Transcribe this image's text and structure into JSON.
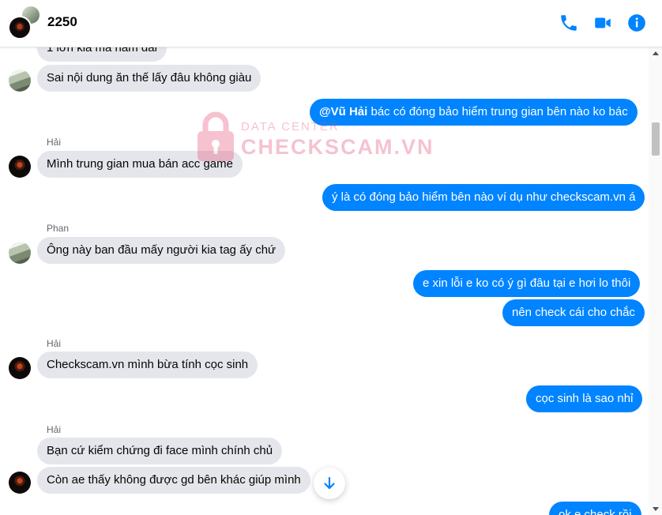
{
  "header": {
    "title": "2250",
    "icons": [
      "phone-icon",
      "video-icon",
      "info-icon"
    ],
    "accent_color": "#0084ff"
  },
  "watermark": {
    "line1": "DATA CENTER",
    "line2": "CHECKSCAM.VN",
    "icon": "lock-icon"
  },
  "messages": [
    {
      "side": "in",
      "sender": "",
      "text": "1 lớn kia mà nằm dài"
    },
    {
      "side": "in",
      "sender": "",
      "text": "Sai nội dung ăn thế lấy đâu không giàu"
    },
    {
      "side": "out",
      "mention": "@Vũ Hải",
      "text": " bác có đóng bảo hiểm trung gian bên nào ko bác"
    },
    {
      "side": "in",
      "sender": "Hải",
      "text": "Mình trung gian mua bán acc game"
    },
    {
      "side": "out",
      "text": "ý là có đóng bảo hiểm bên nào ví dụ như checkscam.vn á"
    },
    {
      "side": "in",
      "sender": "Phan",
      "text": "Ông này ban đầu mấy người kia tag ấy chứ"
    },
    {
      "side": "out",
      "text": "e xin lỗi e ko có ý gì đâu tại e hơi lo thôi"
    },
    {
      "side": "out",
      "text": "nên check cái cho chắc"
    },
    {
      "side": "in",
      "sender": "Hải",
      "text": "Checkscam.vn mình bừa tính cọc sinh"
    },
    {
      "side": "out",
      "text": "cọc sinh là sao nhỉ"
    },
    {
      "side": "in",
      "sender": "Hải",
      "text": "Bạn cứ kiểm chứng đi face mình chính chủ"
    },
    {
      "side": "in",
      "sender": "",
      "text": "Còn ae thấy không được gd bên khác giúp mình"
    },
    {
      "side": "out",
      "text": "ok e check rồi"
    }
  ],
  "jump_button_icon": "arrow-down-icon"
}
